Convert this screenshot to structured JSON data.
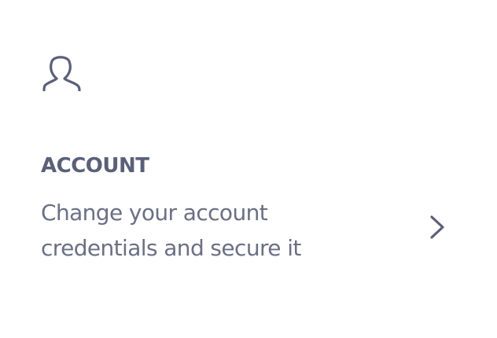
{
  "card": {
    "icon": "user-icon",
    "title": "ACCOUNT",
    "description": "Change your account credentials and secure it",
    "action_icon": "chevron-right-icon"
  },
  "colors": {
    "title": "#5a6078",
    "text": "#6a6f84",
    "icon": "#5a6078",
    "background": "#ffffff"
  }
}
